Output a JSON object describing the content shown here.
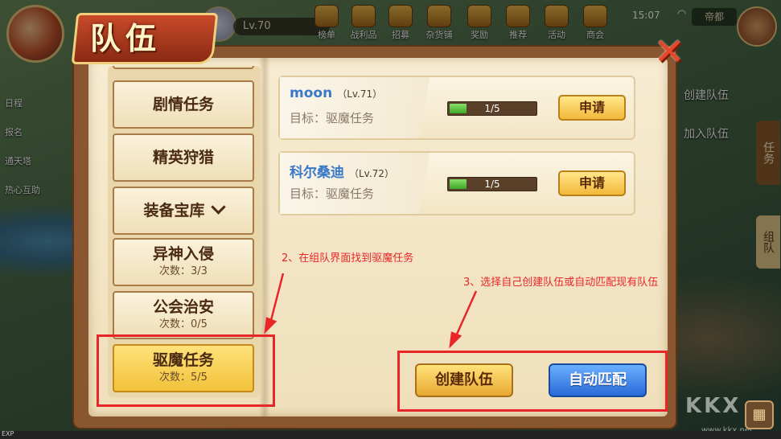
{
  "hud": {
    "level": "Lv.70",
    "menu": [
      "榜单",
      "战利品",
      "招募",
      "杂货铺",
      "奖励",
      "推荐",
      "活动",
      "商会"
    ],
    "clock": "15:07",
    "server": "帝都"
  },
  "left_world": [
    "日程",
    "报名",
    "通天塔",
    "热心互助"
  ],
  "right_panel": {
    "create_team": "创建队伍",
    "join_team": "加入队伍",
    "tab_task": "任务",
    "tab_team": "组队"
  },
  "panel": {
    "title": "队伍",
    "close_icon": "✕"
  },
  "categories": [
    {
      "name": "剧情任务",
      "count": ""
    },
    {
      "name": "精英狩猎",
      "count": ""
    },
    {
      "name": "装备宝库",
      "count": ""
    },
    {
      "name": "异神入侵",
      "count": "次数：3/3"
    },
    {
      "name": "公会治安",
      "count": "次数：0/5"
    },
    {
      "name": "驱魔任务",
      "count": "次数：5/5"
    }
  ],
  "teams": [
    {
      "name": "moon",
      "level": "（Lv.71）",
      "goal": "目标：驱魔任务",
      "progress": 0.2,
      "progress_text": "1/5",
      "apply": "申请"
    },
    {
      "name": "科尔桑迪",
      "level": "（Lv.72）",
      "goal": "目标：驱魔任务",
      "progress": 0.2,
      "progress_text": "1/5",
      "apply": "申请"
    }
  ],
  "actions": {
    "create": "创建队伍",
    "auto_match": "自动匹配"
  },
  "annotations": {
    "step2": "2、在组队界面找到驱魔任务",
    "step3": "3、选择自己创建队伍或自动匹配现有队伍"
  },
  "watermark": "KKX",
  "watermark_url": "www.kkx.net",
  "exp_label": "EXP",
  "colors": {
    "highlight": "#e8262a",
    "team_name": "#3a78c8",
    "active_category": "#f2c23a"
  }
}
